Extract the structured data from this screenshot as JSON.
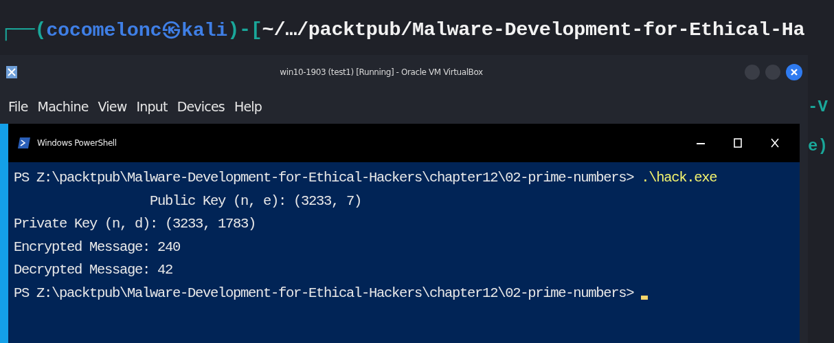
{
  "kali_prompt": [
    {
      "kind": "frame",
      "text": "┌──("
    },
    {
      "kind": "user",
      "text": "cocomelonc㉿kali"
    },
    {
      "kind": "frame",
      "text": ")-["
    },
    {
      "kind": "path",
      "text": "~/…/packtpub/Malware-Development-for-Ethical-Ha"
    }
  ],
  "vm_window": {
    "title": "win10-1903 (test1) [Running] - Oracle VM VirtualBox",
    "menu": [
      "File",
      "Machine",
      "View",
      "Input",
      "Devices",
      "Help"
    ]
  },
  "side_fragments": [
    "-V",
    "e)"
  ],
  "powershell": {
    "title": "Windows PowerShell",
    "lines": [
      {
        "text": "PS Z:\\packtpub\\Malware-Development-for-Ethical-Hackers\\chapter12\\02-prime-numbers> ",
        "command": ".\\hack.exe"
      },
      {
        "text": "                  Public Key (n, e): (3233, 7)"
      },
      {
        "text": "Private Key (n, d): (3233, 1783)"
      },
      {
        "text": "Encrypted Message: 240"
      },
      {
        "text": "Decrypted Message: 42"
      },
      {
        "text": "PS Z:\\packtpub\\Malware-Development-for-Ethical-Hackers\\chapter12\\02-prime-numbers> ",
        "cursor": true
      }
    ]
  }
}
